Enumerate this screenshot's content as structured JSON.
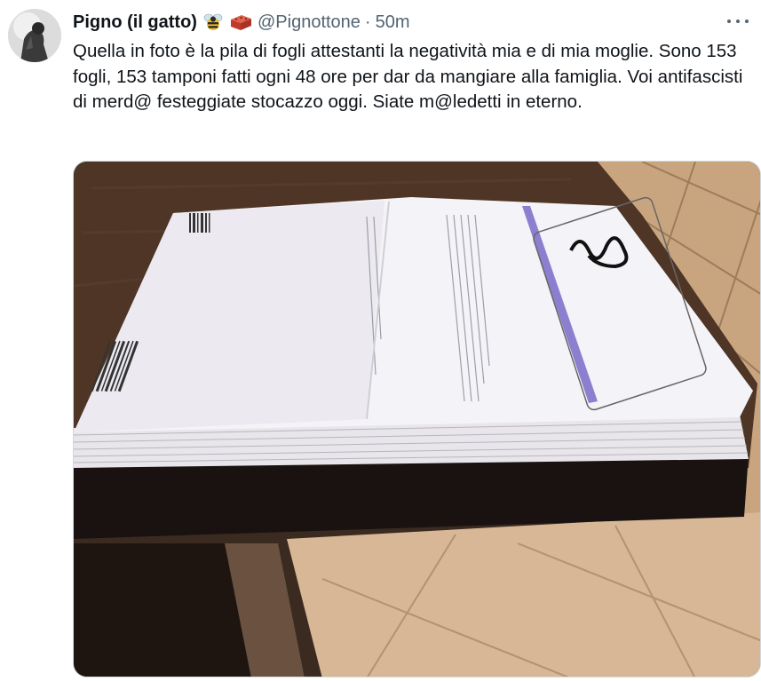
{
  "tweet": {
    "display_name": "Pigno (il gatto)",
    "name_emojis": [
      "bee-emoji",
      "brick-emoji"
    ],
    "handle": "@Pignottone",
    "separator": "·",
    "time": "50m",
    "text": "Quella in foto è la pila di fogli attestanti la negatività mia e di mia moglie. Sono 153 fogli, 153 tamponi fatti ogni 48 ore per dar da mangiare alla famiglia. Voi antifascisti di merd@ festeggiate stocazzo oggi. Siate m@ledetti in eterno."
  },
  "media": {
    "type": "photo",
    "subject": "stack-of-papers-on-table"
  },
  "colors": {
    "text_primary": "#0f1419",
    "text_secondary": "#536471",
    "media_border": "#cfd9de"
  }
}
